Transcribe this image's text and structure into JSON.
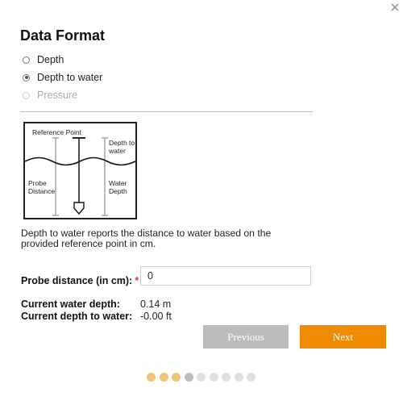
{
  "dialog": {
    "title": "Data Format",
    "close_icon": "close-icon"
  },
  "data_format": {
    "options": [
      {
        "label": "Depth",
        "checked": false,
        "disabled": false
      },
      {
        "label": "Depth to water",
        "checked": true,
        "disabled": false
      },
      {
        "label": "Pressure",
        "checked": false,
        "disabled": true
      }
    ]
  },
  "diagram": {
    "reference_point": "Reference Point",
    "depth_to_water_line1": "Depth to",
    "depth_to_water_line2": "water",
    "probe_distance_line1": "Probe",
    "probe_distance_line2": "Distance",
    "water_depth_line1": "Water",
    "water_depth_line2": "Depth"
  },
  "description": "Depth to water reports the distance to water based on the provided reference point in cm.",
  "probe": {
    "label": "Probe distance (in cm):",
    "required_marker": "*",
    "value": "0"
  },
  "info": {
    "water_depth_label": "Current water depth:",
    "water_depth_value": "0.14 m",
    "depth_to_water_label": "Current depth to water:",
    "depth_to_water_value": "-0.00 ft"
  },
  "buttons": {
    "previous": "Previous",
    "next": "Next"
  },
  "steps": {
    "total": 9,
    "current": 4,
    "colors": {
      "completed": "#f2c27a",
      "current": "#bdbdbd",
      "upcoming": "#e0e0e0"
    }
  },
  "colors": {
    "accent": "#f08a00",
    "disabled_button": "#bbbbbb",
    "required": "#dd3333"
  }
}
